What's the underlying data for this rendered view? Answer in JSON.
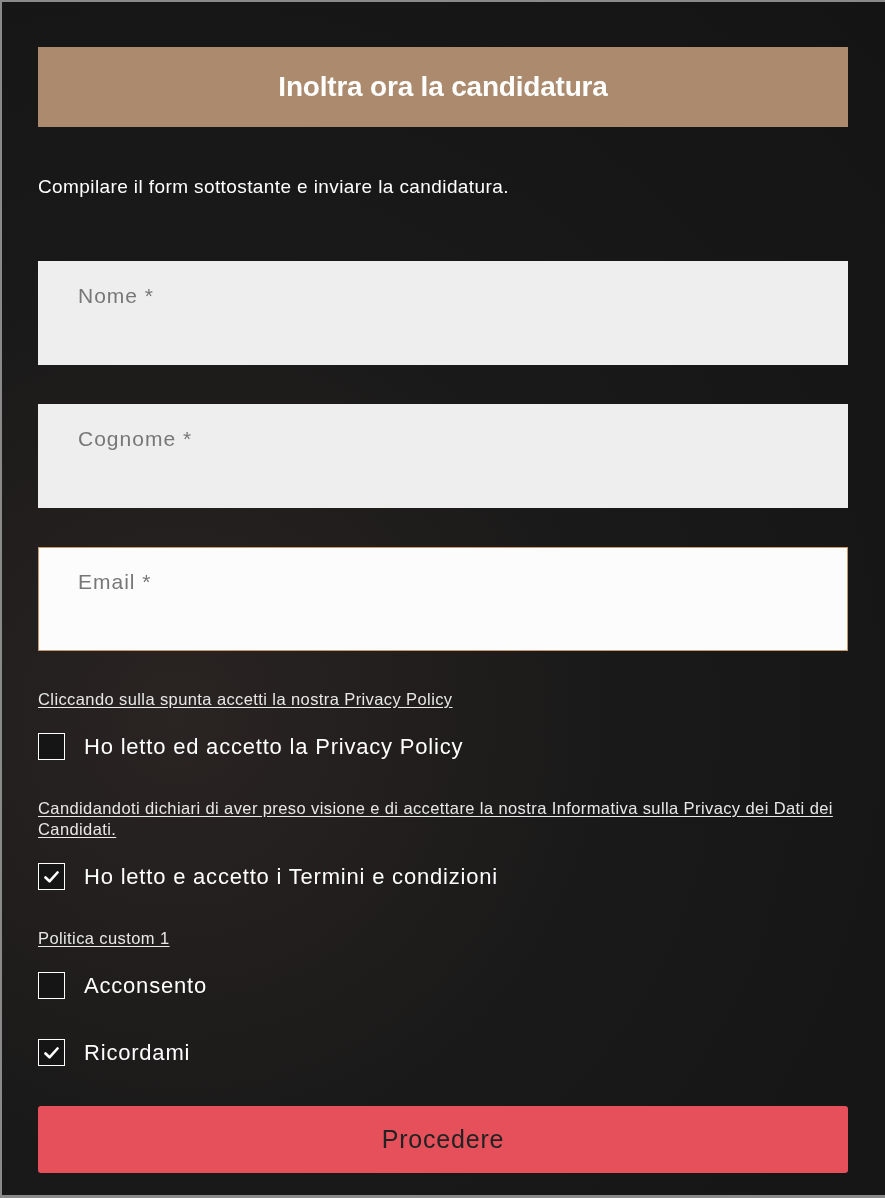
{
  "header": {
    "title": "Inoltra ora la candidatura"
  },
  "intro": "Compilare il form sottostante e inviare la candidatura.",
  "fields": [
    {
      "placeholder": "Nome *",
      "focused": false
    },
    {
      "placeholder": "Cognome *",
      "focused": false
    },
    {
      "placeholder": "Email *",
      "focused": true
    }
  ],
  "consent_items": [
    {
      "kind": "link",
      "text": "Cliccando sulla spunta accetti la nostra Privacy Policy"
    },
    {
      "kind": "checkbox",
      "label": "Ho letto ed accetto la Privacy Policy",
      "checked": false
    },
    {
      "kind": "link",
      "text": "Candidandoti dichiari di aver preso visione e di accettare la nostra Informativa sulla Privacy dei Dati dei Candidati."
    },
    {
      "kind": "checkbox",
      "label": "Ho letto e accetto i Termini e condizioni",
      "checked": true
    },
    {
      "kind": "link",
      "text": "Politica custom 1"
    },
    {
      "kind": "checkbox",
      "label": "Acconsento",
      "checked": false
    },
    {
      "kind": "checkbox",
      "label": "Ricordami",
      "checked": true
    }
  ],
  "submit_button": {
    "label": "Procedere"
  }
}
